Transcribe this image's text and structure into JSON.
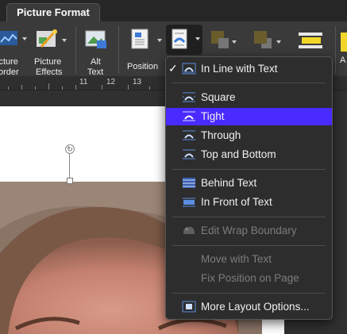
{
  "tab": {
    "label": "Picture Format"
  },
  "ribbon": {
    "picture_border": [
      "icture",
      "order"
    ],
    "picture_effects": [
      "Picture",
      "Effects"
    ],
    "alt_text": [
      "Alt",
      "Text"
    ],
    "position": "Position",
    "cut_label": "A"
  },
  "ruler": {
    "numbers": [
      "11",
      "12",
      "13"
    ]
  },
  "wrap_menu": {
    "items": [
      {
        "label": "In Line with Text",
        "checked": true,
        "icon": "inline-wrap-icon"
      },
      {
        "label": "Square",
        "icon": "square-wrap-icon"
      },
      {
        "label": "Tight",
        "highlighted": true,
        "icon": "tight-wrap-icon"
      },
      {
        "label": "Through",
        "icon": "through-wrap-icon"
      },
      {
        "label": "Top and Bottom",
        "icon": "top-bottom-wrap-icon"
      },
      {
        "label": "Behind Text",
        "icon": "behind-text-icon"
      },
      {
        "label": "In Front of Text",
        "icon": "in-front-text-icon"
      },
      {
        "label": "Edit Wrap Boundary",
        "disabled": true,
        "icon": "edit-boundary-icon"
      },
      {
        "label": "Move with Text",
        "disabled": true
      },
      {
        "label": "Fix Position on Page",
        "disabled": true
      },
      {
        "label": "More Layout Options...",
        "icon": "layout-options-icon"
      }
    ],
    "check_glyph": "✓"
  },
  "colors": {
    "highlight": "#4a2bff",
    "menu_bg": "#2d2d2d",
    "ribbon_bg": "#3a3a3a"
  }
}
